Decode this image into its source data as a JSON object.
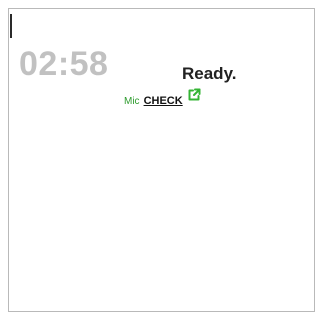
{
  "timer": {
    "value": "02:58"
  },
  "status": {
    "text": "Ready."
  },
  "mic_check": {
    "prefix": "Mic",
    "link_label": "CHECK",
    "icon": "external-link-icon"
  },
  "colors": {
    "timer_text": "#c1c1c1",
    "status_text": "#222222",
    "mic_text": "#2e9c2e",
    "link_text": "#111111",
    "icon": "#35b435",
    "border": "#b9b9b9"
  }
}
